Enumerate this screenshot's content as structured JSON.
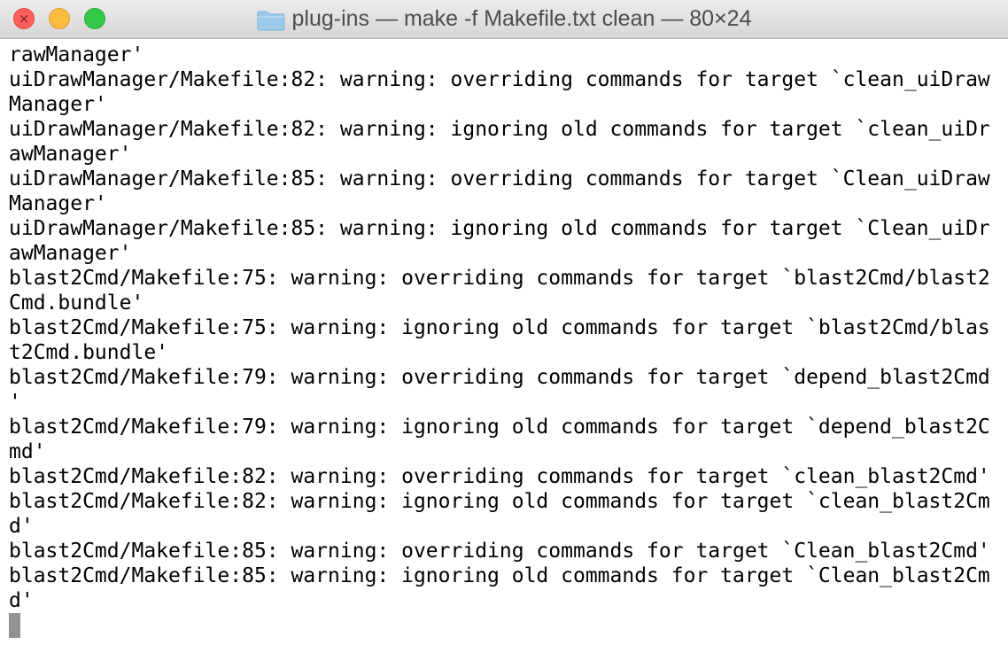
{
  "window": {
    "title": "plug-ins — make -f Makefile.txt clean — 80×24",
    "close_glyph": "×",
    "colors": {
      "close": "#fc605c",
      "minimize": "#fdbc40",
      "zoom": "#34c84a",
      "folder": "#9ccaea"
    }
  },
  "terminal": {
    "lines": [
      "rawManager'",
      "uiDrawManager/Makefile:82: warning: overriding commands for target `clean_uiDraw",
      "Manager'",
      "uiDrawManager/Makefile:82: warning: ignoring old commands for target `clean_uiDr",
      "awManager'",
      "uiDrawManager/Makefile:85: warning: overriding commands for target `Clean_uiDraw",
      "Manager'",
      "uiDrawManager/Makefile:85: warning: ignoring old commands for target `Clean_uiDr",
      "awManager'",
      "blast2Cmd/Makefile:75: warning: overriding commands for target `blast2Cmd/blast2",
      "Cmd.bundle'",
      "blast2Cmd/Makefile:75: warning: ignoring old commands for target `blast2Cmd/blas",
      "t2Cmd.bundle'",
      "blast2Cmd/Makefile:79: warning: overriding commands for target `depend_blast2Cmd",
      "'",
      "blast2Cmd/Makefile:79: warning: ignoring old commands for target `depend_blast2C",
      "md'",
      "blast2Cmd/Makefile:82: warning: overriding commands for target `clean_blast2Cmd'",
      "blast2Cmd/Makefile:82: warning: ignoring old commands for target `clean_blast2Cm",
      "d'",
      "blast2Cmd/Makefile:85: warning: overriding commands for target `Clean_blast2Cmd'",
      "blast2Cmd/Makefile:85: warning: ignoring old commands for target `Clean_blast2Cm",
      "d'"
    ]
  }
}
